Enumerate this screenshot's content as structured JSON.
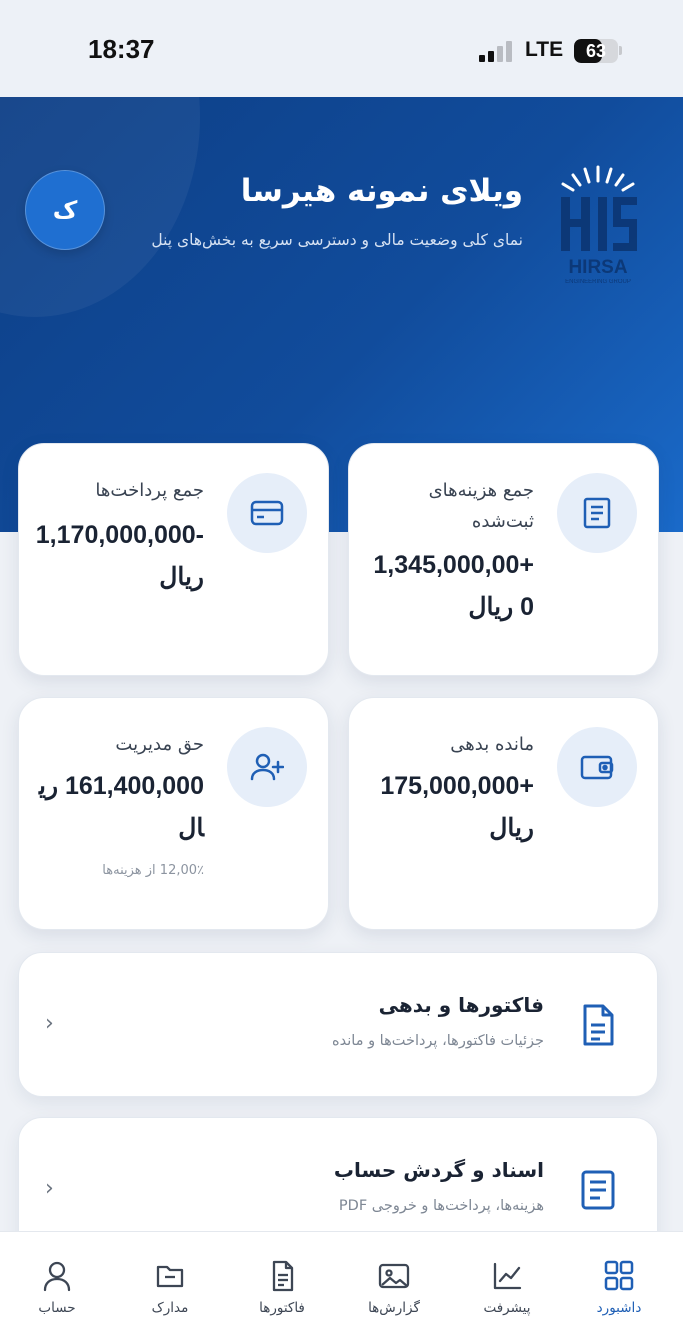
{
  "status_bar": {
    "time": "18:37",
    "network": "LTE",
    "battery": "63",
    "battery_level": 0.63
  },
  "header": {
    "title": "ویلای نمونه هیرسا",
    "subtitle": "نمای کلی وضعیت مالی و دسترسی سریع به بخش‌های پنل",
    "avatar_letter": "ک",
    "logo_text": "HIRSA",
    "logo_subtext": "ENGINEERING GROUP"
  },
  "stats": [
    {
      "icon": "document-icon",
      "label": "جمع هزینه‌های ثبت‌شده",
      "value": "+1,345,000,000 ریال"
    },
    {
      "icon": "card-icon",
      "label": "جمع پرداخت‌ها",
      "value": "-1,170,000,000 ریال"
    },
    {
      "icon": "wallet-icon",
      "label": "مانده بدهی",
      "value": "+175,000,000 ریال"
    },
    {
      "icon": "user-plus-icon",
      "label": "حق مدیریت",
      "value": "161,400,000 ریال",
      "note": "12,00٪ از هزینه‌ها"
    }
  ],
  "sections": [
    {
      "icon": "invoice-icon",
      "title": "فاکتورها و بدهی",
      "subtitle": "جزئیات فاکتورها، پرداخت‌ها و مانده",
      "chevron": "‹"
    },
    {
      "icon": "ledger-icon",
      "title": "اسناد و گردش حساب",
      "subtitle": "هزینه‌ها، پرداخت‌ها و خروجی PDF",
      "chevron": "‹"
    }
  ],
  "tabs": [
    {
      "icon": "grid-icon",
      "label": "داشبورد",
      "active": true
    },
    {
      "icon": "chart-icon",
      "label": "پیشرفت",
      "active": false
    },
    {
      "icon": "image-icon",
      "label": "گزارش‌ها",
      "active": false
    },
    {
      "icon": "invoice-icon",
      "label": "فاکتورها",
      "active": false
    },
    {
      "icon": "folder-icon",
      "label": "مدارک",
      "active": false
    },
    {
      "icon": "user-icon",
      "label": "حساب",
      "active": false
    }
  ],
  "colors": {
    "primary": "#1f5fb5",
    "hero_dark": "#0d3f86",
    "hero_light": "#1a6ac9",
    "icon_bg": "#e6eef9"
  }
}
